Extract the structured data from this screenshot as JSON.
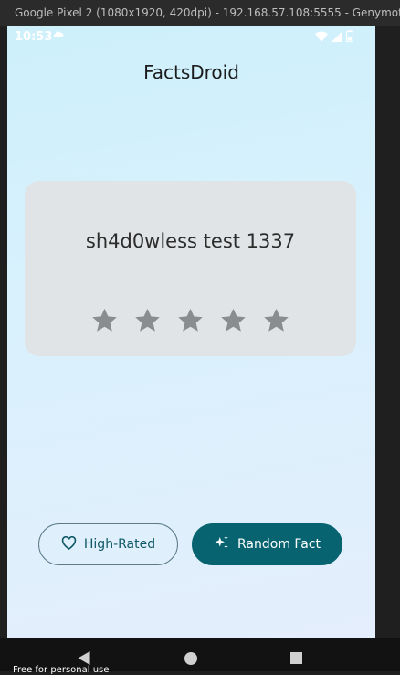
{
  "window": {
    "title": "Google Pixel 2 (1080x1920, 420dpi) - 192.168.57.108:5555 - Genymotion"
  },
  "status_bar": {
    "time": "10:53",
    "icons": [
      "cloud-icon",
      "wifi-icon",
      "signal-icon",
      "battery-icon"
    ]
  },
  "app": {
    "title": "FactsDroid"
  },
  "fact_card": {
    "text": "sh4d0wless test 1337",
    "rating": 0,
    "max_rating": 5,
    "star_color": "#8a8d8f"
  },
  "buttons": {
    "high_rated": "High-Rated",
    "random_fact": "Random Fact"
  },
  "colors": {
    "accent": "#06636f",
    "card_bg": "#e0e4e6"
  },
  "watermark": "Free for personal use"
}
